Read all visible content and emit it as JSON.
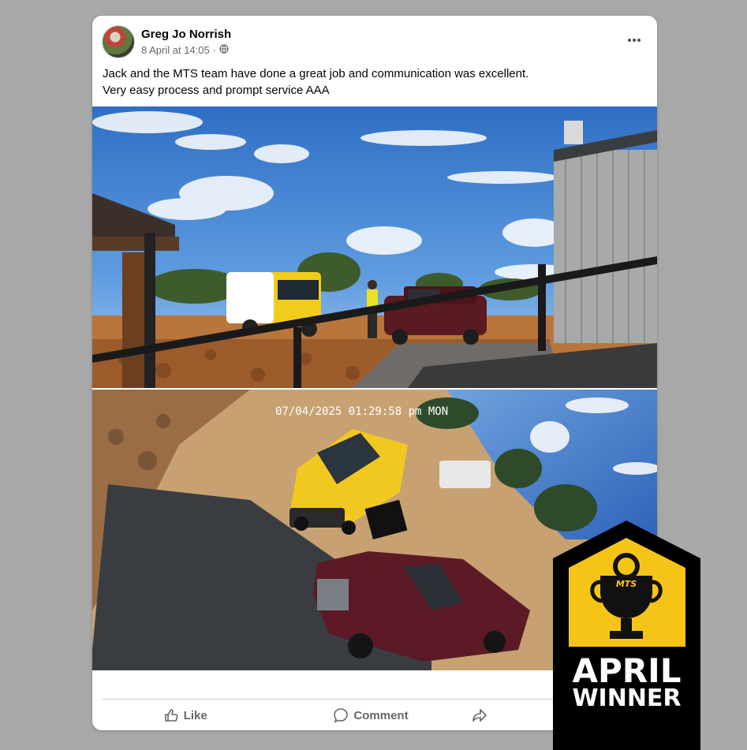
{
  "post": {
    "author": "Greg Jo Norrish",
    "timestamp": "8 April at 14:05",
    "separator": "·",
    "privacy_icon": "globe-icon",
    "text_line1": "Jack and the MTS team have done a great job and communication was excellent.",
    "text_line2": "Very easy process and prompt service AAA"
  },
  "photos": {
    "cctv_overlay": "07/04/2025 01:29:58 pm MON"
  },
  "actions": {
    "like_label": "Like",
    "comment_label": "Comment",
    "share_icon": "share-icon"
  },
  "badge": {
    "brand": "MTS",
    "line1": "APRIL",
    "line2": "WINNER",
    "colors": {
      "yellow": "#f6c417",
      "black": "#000000",
      "grey": "#3a3a3a"
    }
  },
  "colors": {
    "background": "#a8a8a8",
    "card": "#ffffff",
    "text_primary": "#050505",
    "text_secondary": "#65676b"
  }
}
